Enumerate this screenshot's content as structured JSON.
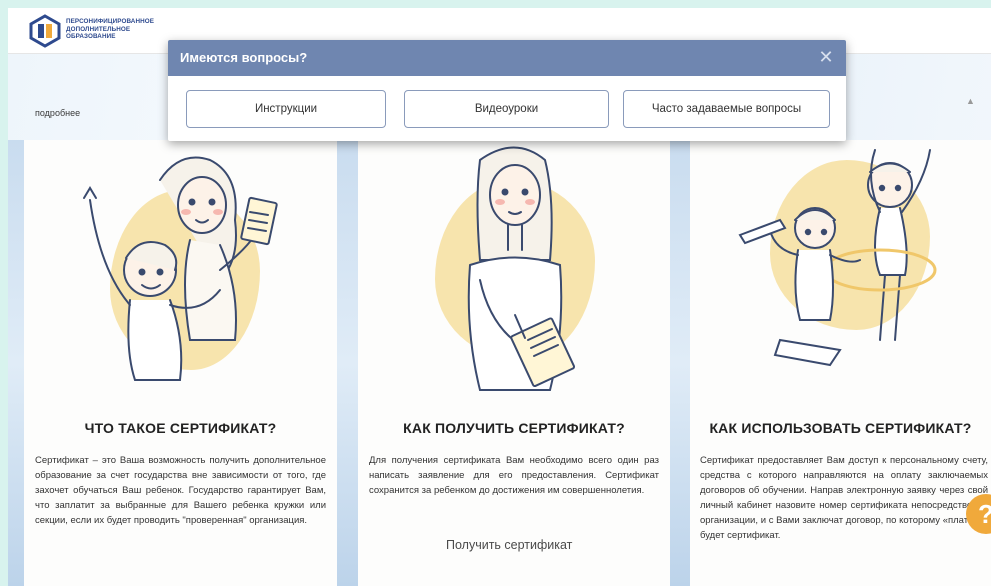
{
  "header": {
    "logo_lines": [
      "ПЕРСОНИФИЦИРОВАННОЕ",
      "ДОПОЛНИТЕЛЬНОЕ",
      "ОБРАЗОВАНИЕ"
    ]
  },
  "more_link": "подробнее",
  "modal": {
    "title": "Имеются вопросы?",
    "close_label": "✕",
    "buttons": [
      "Инструкции",
      "Видеоуроки",
      "Часто задаваемые вопросы"
    ]
  },
  "columns": [
    {
      "title": "ЧТО ТАКОЕ СЕРТИФИКАТ?",
      "text": "Сертификат – это Ваша возможность получить дополнительное образование за счет государства вне зависимости от того, где захочет обучаться Ваш ребенок. Государство гарантирует Вам, что заплатит за выбранные для Вашего ребенка кружки или секции, если их будет проводить \"проверенная\" организация."
    },
    {
      "title": "КАК ПОЛУЧИТЬ СЕРТИФИКАТ?",
      "text": "Для получения сертификата Вам необходимо всего один раз написать заявление для его предоставления. Сертификат сохранится за ребенком до достижения им совершеннолетия.",
      "link": "Получить сертификат"
    },
    {
      "title": "КАК ИСПОЛЬЗОВАТЬ СЕРТИФИКАТ?",
      "text": "Сертификат предоставляет Вам доступ к персональному счету, средства с которого направляются на оплату заключаемых договоров об обучении. Направ электронную заявку через свой личный кабинет назовите номер сертификата непосредственно организации, и с Вами заключат договор, по которому «платить» будет сертификат."
    }
  ],
  "help_icon_glyph": "?",
  "colors": {
    "modal_header": "#6f86b0",
    "logo_blue": "#2e4a8e",
    "accent_yellow": "#f7e4ad",
    "help_orange": "#f0a93b",
    "frame": "#d8f3ee"
  }
}
